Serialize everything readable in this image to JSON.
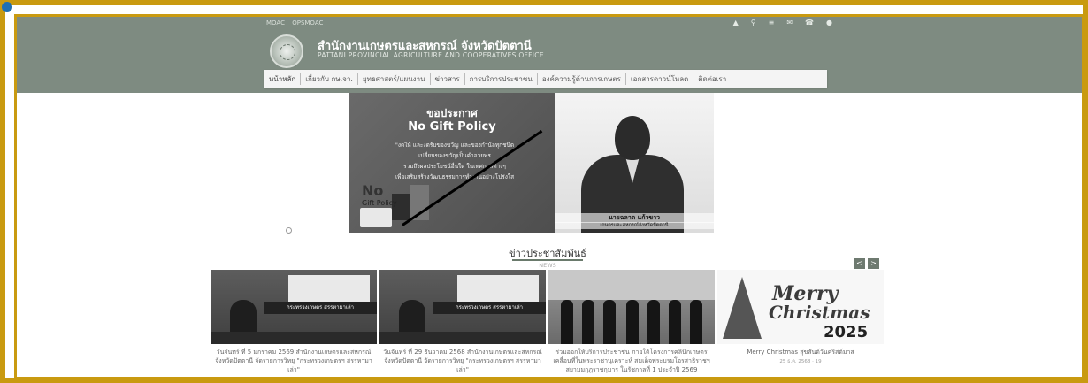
{
  "topbar": {
    "links": [
      "MOAC",
      "OPSMOAC"
    ],
    "icons": [
      "user-icon",
      "search-icon",
      "sitemap-icon",
      "mail-icon",
      "phone-icon",
      "location-icon"
    ]
  },
  "site": {
    "title": "สำนักงานเกษตรและสหกรณ์ จังหวัดปัตตานี",
    "subtitle": "PATTANI PROVINCIAL AGRICULTURE AND COOPERATIVES OFFICE"
  },
  "nav": {
    "items": [
      "หน้าหลัก",
      "เกี่ยวกับ กษ.จว.",
      "ยุทธศาสตร์/แผนงาน",
      "ข่าวสาร",
      "การบริการประชาชน",
      "องค์ความรู้ด้านการเกษตร",
      "เอกสารดาวน์โหลด",
      "ติดต่อเรา"
    ]
  },
  "banner": {
    "announce": "ขอประกาศ",
    "policy": "No Gift Policy",
    "body": [
      "\"งดให้ และงดรับของขวัญ และของกำนัลทุกชนิด",
      "เปลี่ยนของขวัญเป็นคำอวยพร",
      "รวมถึงผลประโยชน์อื่นใด ในเทศกาลต่างๆ",
      "เพื่อเสริมสร้างวัฒนธรรมการทำงานอย่างโปร่งใส"
    ],
    "nogift_big": "No",
    "nogift_small": "Gift Policy",
    "person_name": "นายฉลาด แก้วขาว",
    "person_role": "เกษตรและสหกรณ์จังหวัดปัตตานี"
  },
  "news": {
    "title": "ข่าวประชาสัมพันธ์",
    "subtitle": "NEWS",
    "prev": "<",
    "next": ">",
    "cards": [
      {
        "band": "กระทรวงเกษตร สรรหามาเล่า",
        "band2": "สรรหามาเล่า",
        "text": "วันจันทร์ ที่ 5 มกราคม 2569 สำนักงานเกษตรและสหกรณ์จังหวัดปัตตานี จัดรายการวิทยุ \"กระทรวงเกษตรฯ สรรหามาเล่า\"",
        "meta": ""
      },
      {
        "band": "กระทรวงเกษตร สรรหามาเล่า",
        "band2": "สรรหามาเล่า",
        "text": "วันจันทร์ ที่ 29 ธันวาคม 2568 สำนักงานเกษตรและสหกรณ์จังหวัดปัตตานี จัดรายการวิทยุ \"กระทรวงเกษตรฯ สรรหามาเล่า\"",
        "meta": ""
      },
      {
        "text": "ร่วมออกให้บริการประชาชน ภายใต้โครงการคลินิกเกษตรเคลื่อนที่ในพระราชานุเคราะห์ สมเด็จพระบรมโอรสาธิราชฯ สยามมกุฎราชกุมาร ในรัชกาลที่ 1 ประจำปี 2569",
        "meta": ""
      },
      {
        "merry": "Merry",
        "christmas": "Christmas",
        "year": "2025",
        "text": "Merry Christmas สุขสันต์วันคริสต์มาส",
        "meta": "25 ธ.ค. 2568 · 19"
      }
    ]
  }
}
